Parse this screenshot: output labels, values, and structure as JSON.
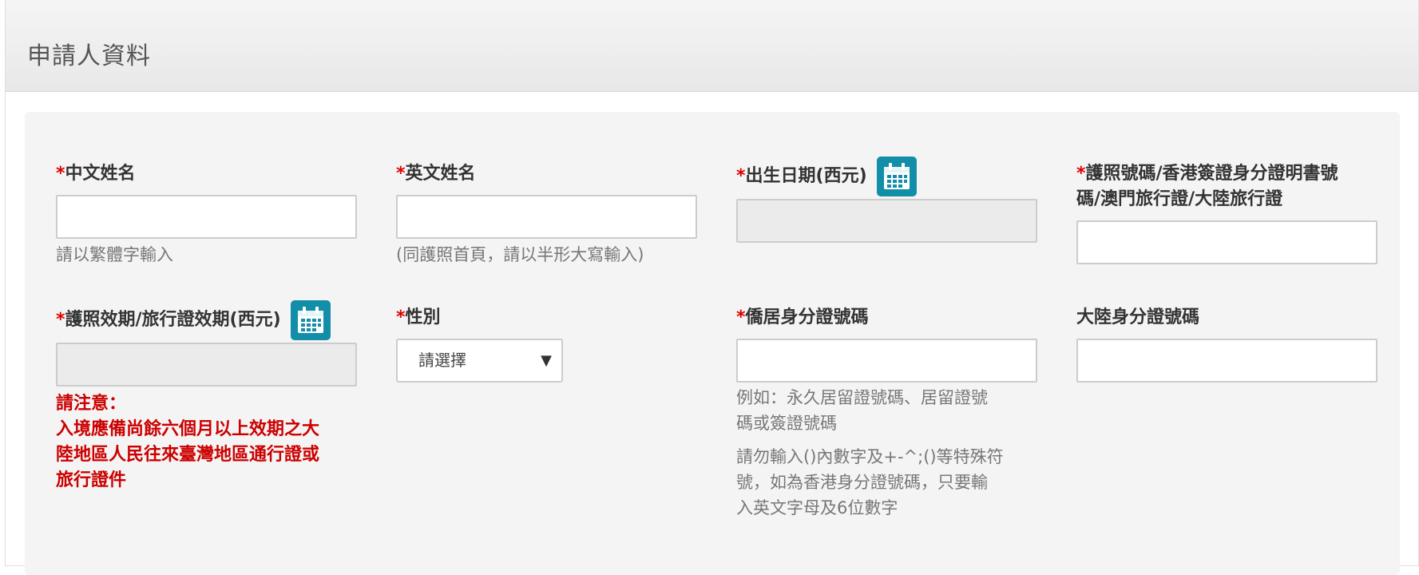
{
  "header": {
    "title": "申請人資料"
  },
  "form": {
    "required_mark": "*",
    "chinese_name": {
      "label": "中文姓名",
      "hint": "請以繁體字輸入",
      "value": ""
    },
    "english_name": {
      "label": "英文姓名",
      "hint": "(同護照首頁，請以半形大寫輸入)",
      "value": ""
    },
    "birth_date": {
      "label": "出生日期(西元)",
      "value": ""
    },
    "passport_no": {
      "label_line1": "護照號碼/香港簽證身分證明書號",
      "label_line2": "碼/澳門旅行證/大陸旅行證",
      "value": ""
    },
    "passport_expiry": {
      "label": "護照效期/旅行證效期(西元)",
      "value": "",
      "warning_title": "請注意：",
      "warning_lines": [
        "入境應備尚餘六個月以上效期之大",
        "陸地區人民往來臺灣地區通行證或",
        "旅行證件"
      ]
    },
    "gender": {
      "label": "性別",
      "selected": "請選擇",
      "arrow": "▼"
    },
    "residence_id": {
      "label": "僑居身分證號碼",
      "value": "",
      "hint1_lines": [
        "例如：永久居留證號碼、居留證號",
        "碼或簽證號碼"
      ],
      "hint2_lines": [
        "請勿輸入()內數字及+-^;()等特殊符",
        "號，如為香港身分證號碼，只要輸",
        "入英文字母及6位數字"
      ]
    },
    "mainland_id": {
      "label": "大陸身分證號碼",
      "value": ""
    }
  },
  "icons": {
    "calendar": "calendar-icon",
    "accent": "#138ea8"
  },
  "colors": {
    "required": "#dd0000",
    "warning": "#cc0000"
  }
}
